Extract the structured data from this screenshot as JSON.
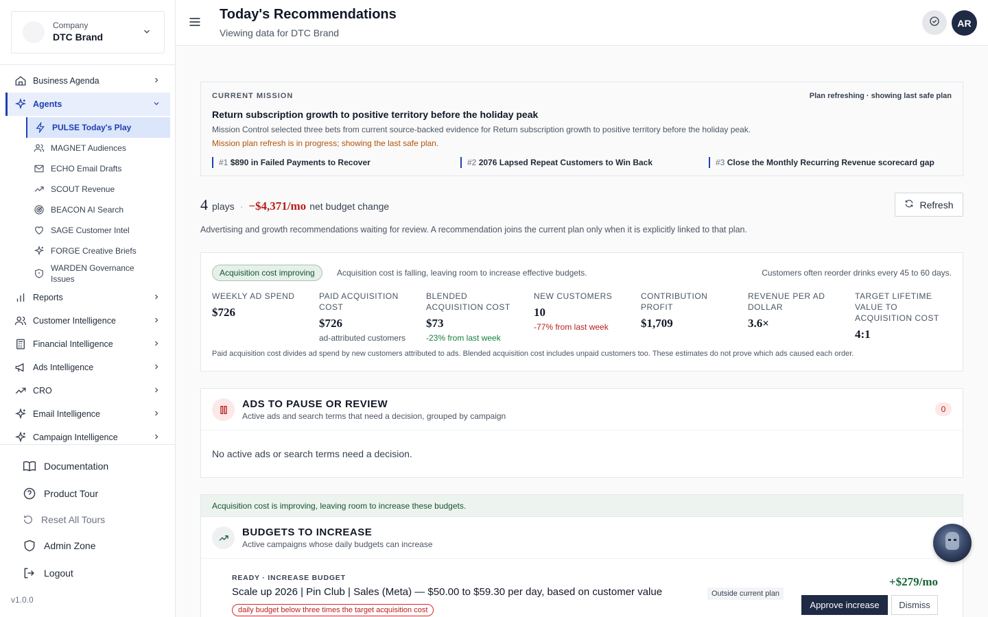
{
  "sidebar": {
    "company_label": "Company",
    "company_name": "DTC Brand",
    "nav": [
      {
        "label": "Business Agenda",
        "icon": "home-icon"
      },
      {
        "label": "Agents",
        "icon": "sparkle-icon"
      },
      {
        "label": "Reports",
        "icon": "bar-chart-icon"
      },
      {
        "label": "Customer Intelligence",
        "icon": "users-icon"
      },
      {
        "label": "Financial Intelligence",
        "icon": "calculator-icon"
      },
      {
        "label": "Ads Intelligence",
        "icon": "megaphone-icon"
      },
      {
        "label": "CRO",
        "icon": "trending-up-icon"
      },
      {
        "label": "Email Intelligence",
        "icon": "sparkle-icon"
      },
      {
        "label": "Campaign Intelligence",
        "icon": "sparkle-icon"
      }
    ],
    "agents": [
      {
        "label": "PULSE Today's Play",
        "icon": "bolt-icon"
      },
      {
        "label": "MAGNET Audiences",
        "icon": "users-icon"
      },
      {
        "label": "ECHO Email Drafts",
        "icon": "mail-icon"
      },
      {
        "label": "SCOUT Revenue",
        "icon": "trending-up-icon"
      },
      {
        "label": "BEACON AI Search",
        "icon": "radar-icon"
      },
      {
        "label": "SAGE Customer Intel",
        "icon": "heart-icon"
      },
      {
        "label": "FORGE Creative Briefs",
        "icon": "sparkle-icon"
      },
      {
        "label": "WARDEN Governance Issues",
        "icon": "shield-icon"
      }
    ],
    "footer": [
      {
        "label": "Documentation",
        "icon": "book-icon"
      },
      {
        "label": "Product Tour",
        "icon": "help-icon"
      },
      {
        "label": "Reset All Tours",
        "icon": "reset-icon"
      },
      {
        "label": "Admin Zone",
        "icon": "shield-icon"
      },
      {
        "label": "Logout",
        "icon": "logout-icon"
      }
    ],
    "version": "v1.0.0"
  },
  "header": {
    "title": "Today's Recommendations",
    "subtitle": "Viewing data for DTC Brand",
    "avatar": "AR"
  },
  "mission": {
    "kicker": "CURRENT MISSION",
    "status": "Plan refreshing · showing last safe plan",
    "title": "Return subscription growth to positive territory before the holiday peak",
    "description": "Mission Control selected three bets from current source-backed evidence for Return subscription growth to positive territory before the holiday peak.",
    "warning": "Mission plan refresh is in progress; showing the last safe plan.",
    "bets": [
      {
        "num": "#1",
        "text": "$890 in Failed Payments to Recover"
      },
      {
        "num": "#2",
        "text": "2076 Lapsed Repeat Customers to Win Back"
      },
      {
        "num": "#3",
        "text": "Close the Monthly Recurring Revenue scorecard gap"
      }
    ]
  },
  "summary": {
    "plays_count": "4",
    "plays_label": "plays",
    "budget_change": "−$4,371/mo",
    "budget_label": "net budget change",
    "refresh_label": "Refresh",
    "description": "Advertising and growth recommendations waiting for review. A recommendation joins the current plan only when it is explicitly linked to that plan."
  },
  "metrics": {
    "pill": "Acquisition cost improving",
    "note": "Acquisition cost is falling, leaving room to increase effective budgets.",
    "right_note": "Customers often reorder drinks every 45 to 60 days.",
    "items": [
      {
        "label": "WEEKLY AD SPEND",
        "value": "$726",
        "sub": ""
      },
      {
        "label": "PAID ACQUISITION COST",
        "value": "$726",
        "sub": "ad-attributed customers"
      },
      {
        "label": "BLENDED ACQUISITION COST",
        "value": "$73",
        "sub": "-23% from last week"
      },
      {
        "label": "NEW CUSTOMERS",
        "value": "10",
        "sub": "-77% from last week"
      },
      {
        "label": "CONTRIBUTION PROFIT",
        "value": "$1,709",
        "sub": ""
      },
      {
        "label": "REVENUE PER AD DOLLAR",
        "value": "3.6×",
        "sub": ""
      },
      {
        "label": "TARGET LIFETIME VALUE TO ACQUISITION COST",
        "value": "4:1",
        "sub": ""
      }
    ],
    "footnote": "Paid acquisition cost divides ad spend by new customers attributed to ads. Blended acquisition cost includes unpaid customers too. These estimates do not prove which ads caused each order."
  },
  "pause_section": {
    "title": "ADS TO PAUSE OR REVIEW",
    "subtitle": "Active ads and search terms that need a decision, grouped by campaign",
    "count": "0",
    "empty": "No active ads or search terms need a decision."
  },
  "budget_section": {
    "banner": "Acquisition cost is improving, leaving room to increase these budgets.",
    "title": "BUDGETS TO INCREASE",
    "subtitle": "Active campaigns whose daily budgets can increase",
    "rec": {
      "kicker": "READY · INCREASE BUDGET",
      "title": "Scale up 2026 | Pin Club | Sales (Meta) — $50.00 to $59.30 per day, based on customer value",
      "tag": "Outside current plan",
      "delta": "+$279/mo",
      "approve": "Approve increase",
      "dismiss": "Dismiss",
      "warning": "daily budget below three times the target acquisition cost"
    }
  }
}
